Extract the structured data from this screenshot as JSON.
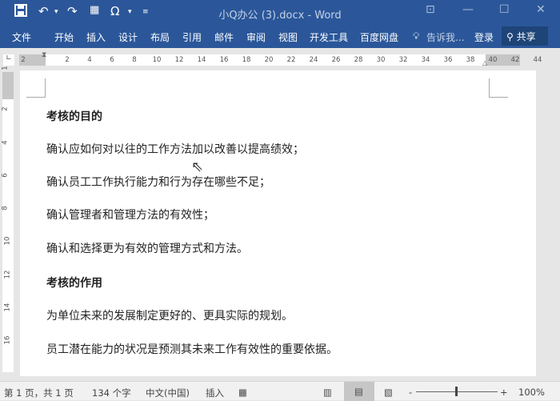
{
  "titlebar": {
    "title": "小Q办公 (3).docx - Word",
    "save_icon": "save-icon",
    "undo_icon": "undo-icon",
    "redo_icon": "redo-icon",
    "symbol_glyph": "Ω",
    "restore_glyph": "⊡",
    "minimize_glyph": "—",
    "maximize_glyph": "☐",
    "close_glyph": "✕"
  },
  "ribbon": {
    "tabs": [
      "文件",
      "开始",
      "插入",
      "设计",
      "布局",
      "引用",
      "邮件",
      "审阅",
      "视图",
      "开发工具",
      "百度网盘"
    ],
    "tell_me": "告诉我...",
    "signin": "登录",
    "share": "共享"
  },
  "ruler": {
    "ticks": [
      "2",
      "2",
      "4",
      "6",
      "8",
      "10",
      "12",
      "14",
      "16",
      "18",
      "20",
      "22",
      "24",
      "26",
      "28",
      "30",
      "32",
      "34",
      "36",
      "38",
      "40",
      "42",
      "44"
    ],
    "vticks": [
      "1",
      "2",
      "4",
      "6",
      "8",
      "10",
      "12",
      "14",
      "16"
    ]
  },
  "document": {
    "lines": [
      {
        "text": "考核的目的",
        "bold": true
      },
      {
        "text": "确认应如何对以往的工作方法加以改善以提高绩效；",
        "bold": false
      },
      {
        "text": "确认员工工作执行能力和行为存在哪些不足；",
        "bold": false
      },
      {
        "text": "确认管理者和管理方法的有效性；",
        "bold": false
      },
      {
        "text": "确认和选择更为有效的管理方式和方法。",
        "bold": false
      },
      {
        "text": "考核的作用",
        "bold": true
      },
      {
        "text": "为单位未来的发展制定更好的、更具实际的规划。",
        "bold": false
      },
      {
        "text": "员工潜在能力的状况是预测其未来工作有效性的重要依据。",
        "bold": false
      }
    ]
  },
  "status": {
    "page": "第 1 页，共 1 页",
    "words": "134 个字",
    "language": "中文(中国)",
    "mode": "插入",
    "zoom": "100%",
    "zoom_minus": "-",
    "zoom_plus": "+",
    "active_view": "print-layout"
  }
}
